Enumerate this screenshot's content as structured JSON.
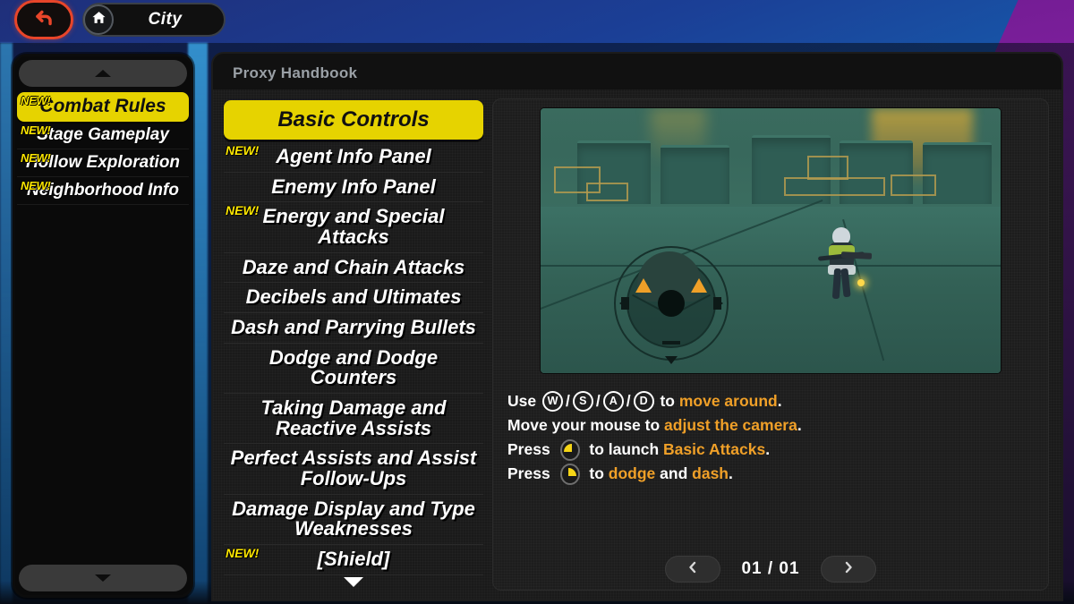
{
  "topbar": {
    "back_icon": "back-arrow-icon",
    "home_icon": "home-icon",
    "location_label": "City"
  },
  "sidebar": {
    "scroll_up_icon": "chevron-up-icon",
    "scroll_down_icon": "chevron-down-icon",
    "new_badge": "NEW!",
    "items": [
      {
        "label": "Combat Rules",
        "new": true,
        "active": true
      },
      {
        "label": "Stage Gameplay",
        "new": true,
        "active": false
      },
      {
        "label": "Hollow Exploration",
        "new": true,
        "active": false
      },
      {
        "label": "Neighborhood Info",
        "new": true,
        "active": false
      }
    ]
  },
  "panel": {
    "title": "Proxy Handbook",
    "new_badge": "NEW!",
    "scroll_down_icon": "chevron-down-icon",
    "topics": [
      {
        "label": "Basic Controls",
        "new": false,
        "active": true
      },
      {
        "label": "Agent Info Panel",
        "new": true,
        "active": false
      },
      {
        "label": "Enemy Info Panel",
        "new": false,
        "active": false
      },
      {
        "label": "Energy and Special Attacks",
        "new": true,
        "active": false
      },
      {
        "label": "Daze and Chain Attacks",
        "new": false,
        "active": false
      },
      {
        "label": "Decibels and Ultimates",
        "new": false,
        "active": false
      },
      {
        "label": "Dash and Parrying Bullets",
        "new": false,
        "active": false
      },
      {
        "label": "Dodge and Dodge Counters",
        "new": false,
        "active": false
      },
      {
        "label": "Taking Damage and Reactive Assists",
        "new": false,
        "active": false
      },
      {
        "label": "Perfect Assists and Assist Follow-Ups",
        "new": false,
        "active": false
      },
      {
        "label": "Damage Display and Type Weaknesses",
        "new": false,
        "active": false
      },
      {
        "label": "[Shield]",
        "new": true,
        "active": false
      }
    ]
  },
  "content": {
    "media_name": "gameplay-preview-image",
    "instructions": [
      {
        "id": "move",
        "parts": [
          {
            "type": "text",
            "value": "Use "
          },
          {
            "type": "key",
            "value": "W"
          },
          {
            "type": "sep",
            "value": "/"
          },
          {
            "type": "key",
            "value": "S"
          },
          {
            "type": "sep",
            "value": "/"
          },
          {
            "type": "key",
            "value": "A"
          },
          {
            "type": "sep",
            "value": "/"
          },
          {
            "type": "key",
            "value": "D"
          },
          {
            "type": "text",
            "value": " to "
          },
          {
            "type": "hl",
            "value": "move around"
          },
          {
            "type": "text",
            "value": "."
          }
        ]
      },
      {
        "id": "camera",
        "parts": [
          {
            "type": "text",
            "value": "Move your mouse to "
          },
          {
            "type": "hl",
            "value": "adjust the camera"
          },
          {
            "type": "text",
            "value": "."
          }
        ]
      },
      {
        "id": "basic-attack",
        "parts": [
          {
            "type": "text",
            "value": "Press "
          },
          {
            "type": "mouse-left",
            "value": "left-mouse-button-icon"
          },
          {
            "type": "text",
            "value": " to launch "
          },
          {
            "type": "hl",
            "value": "Basic Attacks"
          },
          {
            "type": "text",
            "value": "."
          }
        ]
      },
      {
        "id": "dodge-dash",
        "parts": [
          {
            "type": "text",
            "value": "Press "
          },
          {
            "type": "mouse-right",
            "value": "right-mouse-button-icon"
          },
          {
            "type": "text",
            "value": " to "
          },
          {
            "type": "hl",
            "value": "dodge"
          },
          {
            "type": "text",
            "value": " and "
          },
          {
            "type": "hl",
            "value": "dash"
          },
          {
            "type": "text",
            "value": "."
          }
        ]
      }
    ],
    "pager": {
      "prev_icon": "chevron-left-icon",
      "next_icon": "chevron-right-icon",
      "count": "01 / 01"
    }
  },
  "colors": {
    "accent_yellow": "#e6d300",
    "new_yellow": "#ffe800",
    "highlight_orange": "#f0a028",
    "back_red": "#e8452a",
    "panel_dark": "#1a1a1a",
    "bg_blue": "#1b3f96",
    "bg_purple": "#8a24a8"
  }
}
